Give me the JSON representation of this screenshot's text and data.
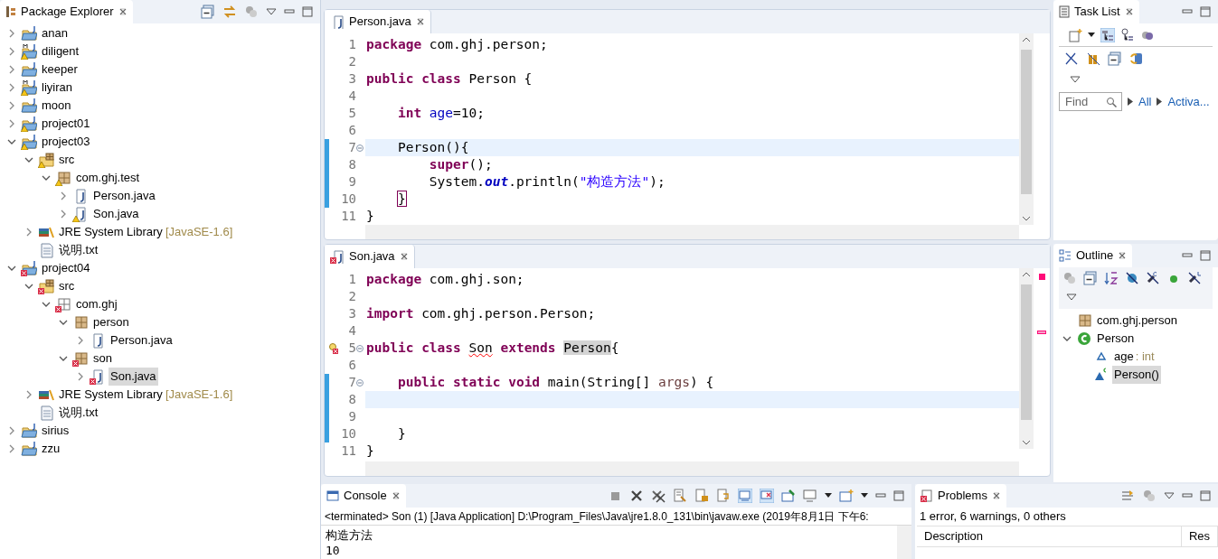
{
  "package_explorer": {
    "title": "Package Explorer",
    "tree": [
      {
        "label": "anan",
        "kind": "project",
        "warning": false,
        "error": false,
        "expandable": true,
        "expanded": false,
        "selected": false
      },
      {
        "label": "diligent",
        "kind": "maven-project",
        "warning": true,
        "error": false,
        "expandable": true,
        "expanded": false,
        "selected": false
      },
      {
        "label": "keeper",
        "kind": "project",
        "warning": false,
        "error": false,
        "expandable": true,
        "expanded": false,
        "selected": false
      },
      {
        "label": "liyiran",
        "kind": "maven-project",
        "warning": true,
        "error": false,
        "expandable": true,
        "expanded": false,
        "selected": false
      },
      {
        "label": "moon",
        "kind": "project",
        "warning": false,
        "error": false,
        "expandable": true,
        "expanded": false,
        "selected": false
      },
      {
        "label": "project01",
        "kind": "project",
        "warning": true,
        "error": false,
        "expandable": true,
        "expanded": false,
        "selected": false
      },
      {
        "label": "project03",
        "kind": "project",
        "warning": true,
        "error": false,
        "expandable": true,
        "expanded": true,
        "selected": false,
        "children": [
          {
            "label": "src",
            "kind": "source-folder",
            "warning": true,
            "error": false,
            "expandable": true,
            "expanded": true,
            "selected": false,
            "children": [
              {
                "label": "com.ghj.test",
                "kind": "package",
                "warning": true,
                "error": false,
                "expandable": true,
                "expanded": true,
                "selected": false,
                "children": [
                  {
                    "label": "Person.java",
                    "kind": "java-file",
                    "warning": false,
                    "error": false,
                    "expandable": true,
                    "expanded": false,
                    "selected": false
                  },
                  {
                    "label": "Son.java",
                    "kind": "java-file",
                    "warning": true,
                    "error": false,
                    "expandable": true,
                    "expanded": false,
                    "selected": false
                  }
                ]
              }
            ]
          },
          {
            "label": "JRE System Library",
            "suffix": "[JavaSE-1.6]",
            "kind": "library",
            "warning": false,
            "error": false,
            "expandable": true,
            "expanded": false,
            "selected": false
          },
          {
            "label": "说明.txt",
            "kind": "text-file",
            "warning": false,
            "error": false,
            "expandable": false,
            "selected": false
          }
        ]
      },
      {
        "label": "project04",
        "kind": "project",
        "warning": false,
        "error": true,
        "expandable": true,
        "expanded": true,
        "selected": false,
        "children": [
          {
            "label": "src",
            "kind": "source-folder",
            "warning": false,
            "error": true,
            "expandable": true,
            "expanded": true,
            "selected": false,
            "children": [
              {
                "label": "com.ghj",
                "kind": "empty-package",
                "warning": false,
                "error": true,
                "expandable": true,
                "expanded": true,
                "selected": false,
                "children": [
                  {
                    "label": "person",
                    "kind": "package",
                    "warning": false,
                    "error": false,
                    "expandable": true,
                    "expanded": true,
                    "selected": false,
                    "children": [
                      {
                        "label": "Person.java",
                        "kind": "java-file",
                        "warning": false,
                        "error": false,
                        "expandable": true,
                        "expanded": false,
                        "selected": false
                      }
                    ]
                  },
                  {
                    "label": "son",
                    "kind": "package",
                    "warning": false,
                    "error": true,
                    "expandable": true,
                    "expanded": true,
                    "selected": false,
                    "children": [
                      {
                        "label": "Son.java",
                        "kind": "java-file",
                        "warning": false,
                        "error": true,
                        "expandable": true,
                        "expanded": false,
                        "selected": true
                      }
                    ]
                  }
                ]
              }
            ]
          },
          {
            "label": "JRE System Library",
            "suffix": "[JavaSE-1.6]",
            "kind": "library",
            "warning": false,
            "error": false,
            "expandable": true,
            "expanded": false,
            "selected": false
          },
          {
            "label": "说明.txt",
            "kind": "text-file",
            "warning": false,
            "error": false,
            "expandable": false,
            "selected": false
          }
        ]
      },
      {
        "label": "sirius",
        "kind": "project",
        "warning": false,
        "error": false,
        "expandable": true,
        "expanded": false,
        "selected": false
      },
      {
        "label": "zzu",
        "kind": "project",
        "warning": false,
        "error": false,
        "expandable": true,
        "expanded": false,
        "selected": false
      }
    ]
  },
  "editors": [
    {
      "tab": "Person.java",
      "has_errors": false,
      "lines": [
        {
          "number": "1",
          "current": false,
          "changed": false,
          "fold": false,
          "error": false,
          "tokens": [
            {
              "kind": "keyword",
              "text": "package"
            },
            {
              "kind": "plain",
              "text": " com.ghj.person;"
            }
          ]
        },
        {
          "number": "2",
          "current": false,
          "changed": false,
          "fold": false,
          "error": false
        },
        {
          "number": "3",
          "current": false,
          "changed": false,
          "fold": false,
          "error": false,
          "tokens": [
            {
              "kind": "keyword",
              "text": "public "
            },
            {
              "kind": "keyword",
              "text": "class"
            },
            {
              "kind": "plain",
              "text": " Person {"
            }
          ]
        },
        {
          "number": "4",
          "current": false,
          "changed": false,
          "fold": false,
          "error": false
        },
        {
          "number": "5",
          "current": false,
          "changed": false,
          "fold": false,
          "error": false,
          "tokens": [
            {
              "kind": "keyword",
              "text": "    int "
            },
            {
              "kind": "field",
              "text": "age"
            },
            {
              "kind": "plain",
              "text": "=10;"
            }
          ]
        },
        {
          "number": "6",
          "current": false,
          "changed": false,
          "fold": false,
          "error": false
        },
        {
          "number": "7",
          "current": true,
          "changed": true,
          "fold": true,
          "error": false,
          "tokens": [
            {
              "kind": "plain",
              "text": "    Person(){"
            }
          ]
        },
        {
          "number": "8",
          "current": false,
          "changed": true,
          "fold": false,
          "error": false,
          "tokens": [
            {
              "kind": "keyword",
              "text": "        super"
            },
            {
              "kind": "plain",
              "text": "();"
            }
          ]
        },
        {
          "number": "9",
          "current": false,
          "changed": true,
          "fold": false,
          "error": false,
          "tokens": [
            {
              "kind": "plain",
              "text": "        System."
            },
            {
              "kind": "static-field",
              "text": "out"
            },
            {
              "kind": "plain",
              "text": ".println("
            },
            {
              "kind": "string",
              "text": "\"构造方法\""
            },
            {
              "kind": "plain",
              "text": ");"
            }
          ]
        },
        {
          "number": "10",
          "current": false,
          "changed": true,
          "fold": false,
          "error": false,
          "tokens": [
            {
              "kind": "bracket-match",
              "text": "    }"
            }
          ]
        },
        {
          "number": "11",
          "current": false,
          "changed": false,
          "fold": false,
          "error": false,
          "tokens": [
            {
              "kind": "plain",
              "text": "}"
            }
          ]
        }
      ]
    },
    {
      "tab": "Son.java",
      "has_errors": true,
      "lines": [
        {
          "number": "1",
          "current": false,
          "changed": false,
          "fold": false,
          "error": false,
          "tokens": [
            {
              "kind": "keyword",
              "text": "package"
            },
            {
              "kind": "plain",
              "text": " com.ghj.son;"
            }
          ]
        },
        {
          "number": "2",
          "current": false,
          "changed": false,
          "fold": false,
          "error": false
        },
        {
          "number": "3",
          "current": false,
          "changed": false,
          "fold": false,
          "error": false,
          "tokens": [
            {
              "kind": "keyword",
              "text": "import"
            },
            {
              "kind": "plain",
              "text": " com.ghj.person.Person;"
            }
          ]
        },
        {
          "number": "4",
          "current": false,
          "changed": false,
          "fold": false,
          "error": false
        },
        {
          "number": "5",
          "current": false,
          "changed": false,
          "fold": true,
          "error": true,
          "tokens": [
            {
              "kind": "keyword",
              "text": "public "
            },
            {
              "kind": "keyword",
              "text": "class "
            },
            {
              "kind": "error",
              "text": "Son"
            },
            {
              "kind": "keyword",
              "text": " extends "
            },
            {
              "kind": "occurrence",
              "text": "Person"
            },
            {
              "kind": "plain",
              "text": "{"
            }
          ]
        },
        {
          "number": "6",
          "current": false,
          "changed": false,
          "fold": false,
          "error": false
        },
        {
          "number": "7",
          "current": false,
          "changed": true,
          "fold": true,
          "error": false,
          "tokens": [
            {
              "kind": "keyword",
              "text": "    public "
            },
            {
              "kind": "keyword",
              "text": "static "
            },
            {
              "kind": "keyword",
              "text": "void"
            },
            {
              "kind": "plain",
              "text": " main(String[] "
            },
            {
              "kind": "parameter",
              "text": "args"
            },
            {
              "kind": "plain",
              "text": ") {"
            }
          ]
        },
        {
          "number": "8",
          "current": true,
          "changed": true,
          "fold": false,
          "error": false
        },
        {
          "number": "9",
          "current": false,
          "changed": true,
          "fold": false,
          "error": false
        },
        {
          "number": "10",
          "current": false,
          "changed": true,
          "fold": false,
          "error": false,
          "tokens": [
            {
              "kind": "plain",
              "text": "    }"
            }
          ]
        },
        {
          "number": "11",
          "current": false,
          "changed": false,
          "fold": false,
          "error": false,
          "tokens": [
            {
              "kind": "plain",
              "text": "}"
            }
          ]
        }
      ]
    }
  ],
  "task_list": {
    "title": "Task List",
    "find_placeholder": "Find",
    "links": [
      "All",
      "Activa..."
    ]
  },
  "outline": {
    "title": "Outline",
    "tree": [
      {
        "label": "com.ghj.person",
        "kind": "package",
        "expandable": false,
        "selected": false
      },
      {
        "label": "Person",
        "kind": "class",
        "expandable": true,
        "expanded": true,
        "selected": false,
        "children": [
          {
            "label": "age",
            "type": " : int",
            "kind": "field",
            "expandable": false,
            "selected": false
          },
          {
            "label": "Person()",
            "kind": "constructor",
            "expandable": false,
            "selected": true
          }
        ]
      }
    ]
  },
  "console": {
    "title": "Console",
    "status": "<terminated> Son (1) [Java Application] D:\\Program_Files\\Java\\jre1.8.0_131\\bin\\javaw.exe (2019年8月1日 下午6:",
    "output": [
      "构造方法",
      "10"
    ]
  },
  "problems": {
    "title": "Problems",
    "summary": "1 error, 6 warnings, 0 others",
    "columns": [
      "Description",
      "Res"
    ]
  }
}
